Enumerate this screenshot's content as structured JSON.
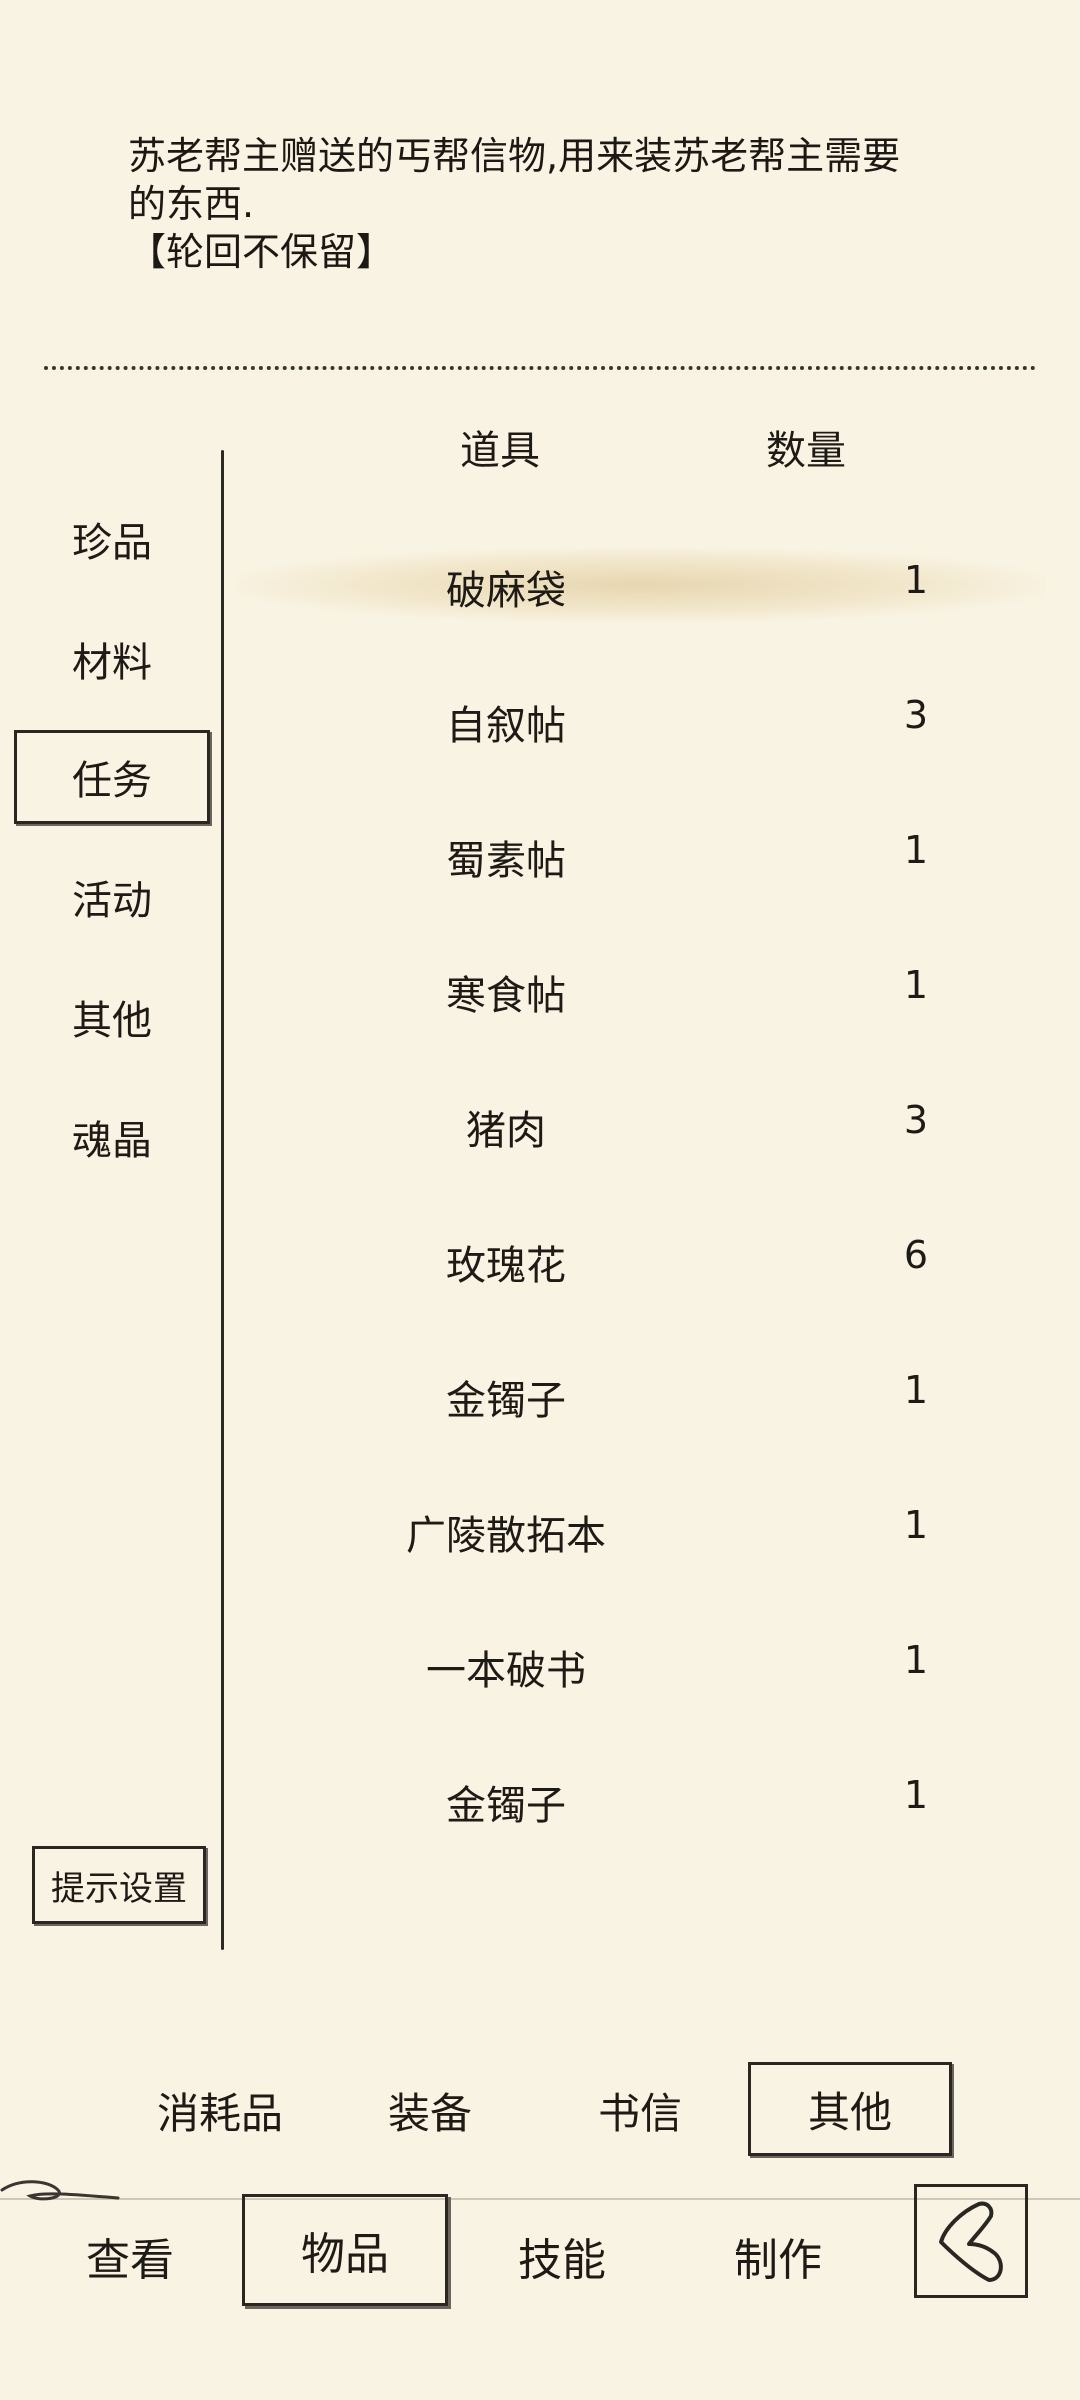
{
  "description": {
    "line1": "苏老帮主赠送的丐帮信物,用来装苏老帮主需要",
    "line2": "的东西.",
    "line3": "【轮回不保留】"
  },
  "table_header": {
    "item": "道具",
    "quantity": "数量"
  },
  "categories": [
    {
      "label": "珍品",
      "active": false
    },
    {
      "label": "材料",
      "active": false
    },
    {
      "label": "任务",
      "active": true
    },
    {
      "label": "活动",
      "active": false
    },
    {
      "label": "其他",
      "active": false
    },
    {
      "label": "魂晶",
      "active": false
    }
  ],
  "items": [
    {
      "name": "破麻袋",
      "qty": "1",
      "selected": true
    },
    {
      "name": "自叙帖",
      "qty": "3"
    },
    {
      "name": "蜀素帖",
      "qty": "1"
    },
    {
      "name": "寒食帖",
      "qty": "1"
    },
    {
      "name": "猪肉",
      "qty": "3"
    },
    {
      "name": "玫瑰花",
      "qty": "6"
    },
    {
      "name": "金镯子",
      "qty": "1"
    },
    {
      "name": "广陵散拓本",
      "qty": "1"
    },
    {
      "name": "一本破书",
      "qty": "1"
    },
    {
      "name": "金镯子",
      "qty": "1"
    }
  ],
  "hint_button": "提示设置",
  "sub_tabs": [
    {
      "label": "消耗品",
      "active": false
    },
    {
      "label": "装备",
      "active": false
    },
    {
      "label": "书信",
      "active": false
    },
    {
      "label": "其他",
      "active": true
    }
  ],
  "bottom_tabs": [
    {
      "label": "查看",
      "active": false
    },
    {
      "label": "物品",
      "active": true
    },
    {
      "label": "技能",
      "active": false
    },
    {
      "label": "制作",
      "active": false
    }
  ],
  "back_icon": "back-arrow-icon",
  "colors": {
    "background": "#f9f3e3",
    "ink": "#1e1a16",
    "highlight": "#e6d3a6"
  }
}
